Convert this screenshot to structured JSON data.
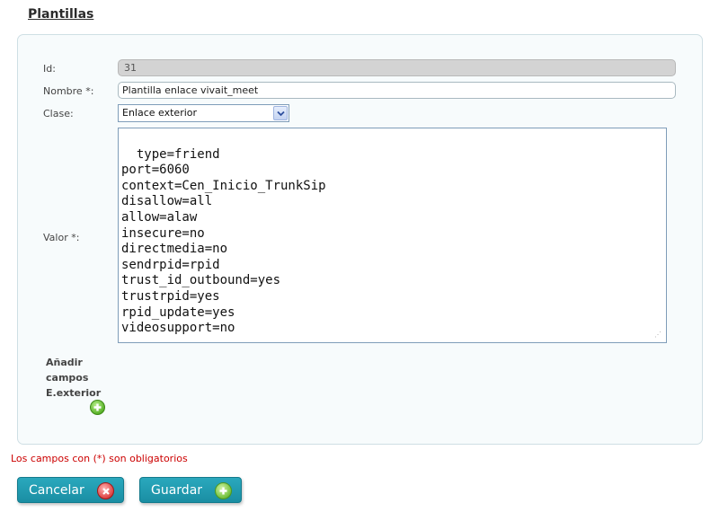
{
  "page": {
    "title": "Plantillas"
  },
  "form": {
    "id_label": "Id:",
    "id_value": "31",
    "nombre_label": "Nombre *:",
    "nombre_value": "Plantilla enlace vivait_meet",
    "clase_label": "Clase:",
    "clase_value": "Enlace exterior",
    "valor_label": "Valor *:",
    "valor_value": "type=friend\nport=6060\ncontext=Cen_Inicio_TrunkSip\ndisallow=all\nallow=alaw\ninsecure=no\ndirectmedia=no\nsendrpid=rpid\ntrust_id_outbound=yes\ntrustrpid=yes\nrpid_update=yes\nvideosupport=no",
    "add_fields_label": "Añadir campos E.exterior"
  },
  "note": "Los campos con (*) son obligatorios",
  "buttons": {
    "cancel": "Cancelar",
    "save": "Guardar"
  },
  "icons": {
    "add": "plus-circle-icon",
    "cancel": "x-circle-icon",
    "save": "plus-circle-icon",
    "dropdown": "chevron-down-icon"
  },
  "colors": {
    "button": "#1f9bb0",
    "required_note": "#cc0000",
    "add_icon": "#5bb32a"
  }
}
